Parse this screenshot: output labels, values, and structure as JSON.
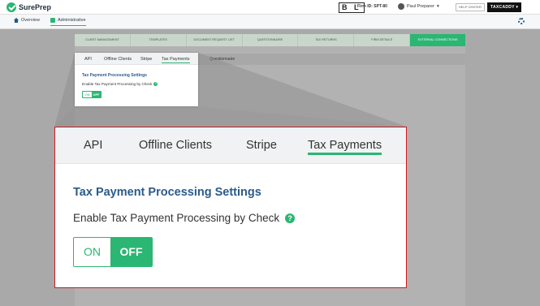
{
  "header": {
    "logo_text": "SurePrep",
    "bl_badge": "B L",
    "firm_id": "Firm ID: SPT-80",
    "user_name": "Paul Preparer",
    "help_label": "HELP CENTER",
    "taxcaddy_label": "TAXCADDY"
  },
  "nav": {
    "overview_label": "Overview",
    "administrative_label": "Administrative"
  },
  "admin_tabs": [
    "CLIENT MANAGEMENT",
    "TEMPLATES",
    "DOCUMENT REQUEST LIST",
    "QUESTIONNAIRE",
    "TAX RETURNS",
    "FIRM DETAILS",
    "EXTERNAL CONNECTIONS"
  ],
  "active_admin_tab": "EXTERNAL CONNECTIONS",
  "background_subtab_label": "Questionnaire",
  "settings": {
    "tabs": [
      "API",
      "Offline Clients",
      "Stripe",
      "Tax Payments"
    ],
    "active_tab": "Tax Payments",
    "title": "Tax Payment Processing Settings",
    "enable_label": "Enable Tax Payment Processing by Check",
    "help_glyph": "?",
    "toggle_on": "ON",
    "toggle_off": "OFF",
    "toggle_state": "OFF"
  },
  "colors": {
    "accent_green": "#2bb673",
    "title_blue": "#2a5b8a",
    "callout_border": "#d3151f"
  },
  "icons": [
    "check-circle-logo-icon",
    "home-icon",
    "admin-icon",
    "user-icon",
    "chevron-down-icon",
    "gear-icon",
    "question-icon"
  ]
}
